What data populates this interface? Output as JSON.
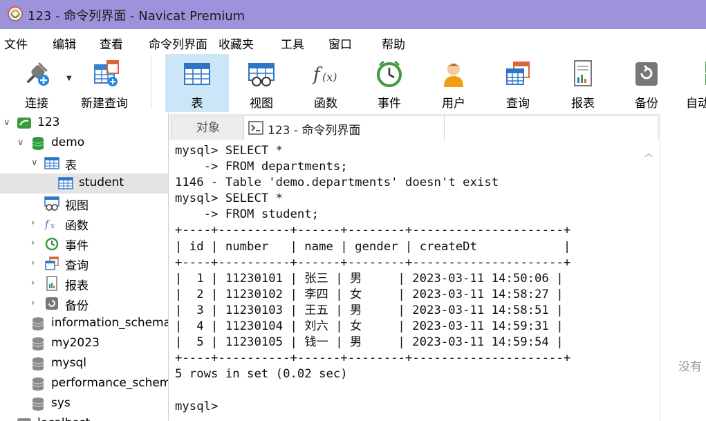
{
  "window": {
    "title": "123 - 命令列界面 - Navicat Premium"
  },
  "menu": [
    "文件",
    "编辑",
    "查看",
    "命令列界面",
    "收藏夹",
    "工具",
    "窗口",
    "帮助"
  ],
  "toolbar": [
    {
      "label": "连接",
      "icon": "plug-icon"
    },
    {
      "label": "新建查询",
      "icon": "new-query-icon"
    },
    {
      "label": "表",
      "icon": "table-icon",
      "active": true
    },
    {
      "label": "视图",
      "icon": "view-icon"
    },
    {
      "label": "函数",
      "icon": "function-icon"
    },
    {
      "label": "事件",
      "icon": "event-clock-icon"
    },
    {
      "label": "用户",
      "icon": "user-icon"
    },
    {
      "label": "查询",
      "icon": "query-icon"
    },
    {
      "label": "报表",
      "icon": "report-icon"
    },
    {
      "label": "备份",
      "icon": "backup-icon"
    },
    {
      "label": "自动",
      "icon": "automation-icon"
    }
  ],
  "tree": [
    {
      "label": "123",
      "icon": "connection-icon",
      "arrow": "open"
    },
    {
      "label": "demo",
      "icon": "database-icon",
      "arrow": "open"
    },
    {
      "label": "表",
      "icon": "table-icon",
      "arrow": "open"
    },
    {
      "label": "student",
      "icon": "table-icon",
      "selected": true
    },
    {
      "label": "视图",
      "icon": "view-icon"
    },
    {
      "label": "函数",
      "icon": "function-icon",
      "arrow": "closed"
    },
    {
      "label": "事件",
      "icon": "event-clock-icon",
      "arrow": "closed"
    },
    {
      "label": "查询",
      "icon": "query-icon",
      "arrow": "closed"
    },
    {
      "label": "报表",
      "icon": "report-icon",
      "arrow": "closed"
    },
    {
      "label": "备份",
      "icon": "backup-icon",
      "arrow": "closed"
    },
    {
      "label": "information_schema",
      "icon": "database-gray-icon"
    },
    {
      "label": "my2023",
      "icon": "database-gray-icon"
    },
    {
      "label": "mysql",
      "icon": "database-gray-icon"
    },
    {
      "label": "performance_schema",
      "icon": "database-gray-icon"
    },
    {
      "label": "sys",
      "icon": "database-gray-icon"
    },
    {
      "label": "localhost",
      "icon": "connection-gray-icon",
      "arrow": "closed"
    }
  ],
  "tabs": {
    "objects": "对象",
    "console": "123 - 命令列界面"
  },
  "console_lines": [
    "mysql> SELECT *",
    "    -> FROM departments;",
    "1146 - Table 'demo.departments' doesn't exist",
    "mysql> SELECT *",
    "    -> FROM student;",
    "+----+----------+------+--------+---------------------+",
    "| id | number   | name | gender | createDt            |",
    "+----+----------+------+--------+---------------------+",
    "|  1 | 11230101 | 张三 | 男     | 2023-03-11 14:50:06 |",
    "|  2 | 11230102 | 李四 | 女     | 2023-03-11 14:58:27 |",
    "|  3 | 11230103 | 王五 | 男     | 2023-03-11 14:58:51 |",
    "|  4 | 11230104 | 刘六 | 女     | 2023-03-11 14:59:31 |",
    "|  5 | 11230105 | 钱一 | 男     | 2023-03-11 14:59:54 |",
    "+----+----------+------+--------+---------------------+",
    "5 rows in set (0.02 sec)",
    "",
    "mysql>"
  ],
  "right_panel": {
    "text": "没有"
  }
}
